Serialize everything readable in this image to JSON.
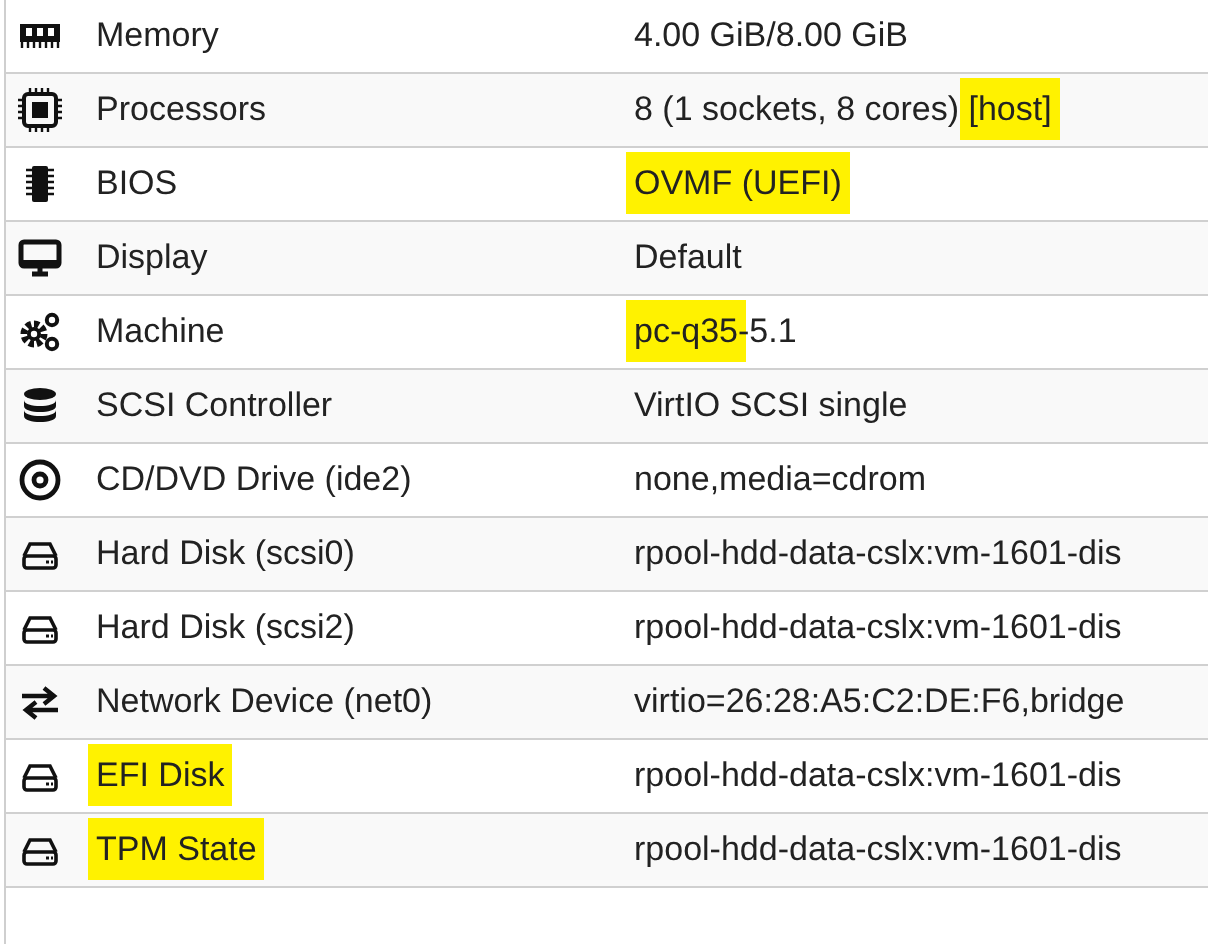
{
  "rows": [
    {
      "kind": "memory",
      "key": [
        {
          "text": "Memory",
          "highlighted": false
        }
      ],
      "value": [
        {
          "text": "4.00 GiB/8.00 GiB",
          "highlighted": false
        }
      ]
    },
    {
      "kind": "cpu",
      "key": [
        {
          "text": "Processors",
          "highlighted": false
        }
      ],
      "value": [
        {
          "text": "8 (1 sockets, 8 cores) ",
          "highlighted": false
        },
        {
          "text": "[host]",
          "highlighted": true
        }
      ]
    },
    {
      "kind": "bios",
      "key": [
        {
          "text": "BIOS",
          "highlighted": false
        }
      ],
      "value": [
        {
          "text": "OVMF (UEFI)",
          "highlighted": true
        }
      ]
    },
    {
      "kind": "display",
      "key": [
        {
          "text": "Display",
          "highlighted": false
        }
      ],
      "value": [
        {
          "text": "Default",
          "highlighted": false
        }
      ]
    },
    {
      "kind": "machine",
      "key": [
        {
          "text": "Machine",
          "highlighted": false
        }
      ],
      "value": [
        {
          "text": "pc-q35",
          "highlighted": true
        },
        {
          "text": "-5.1",
          "highlighted": false
        }
      ]
    },
    {
      "kind": "scsi",
      "key": [
        {
          "text": "SCSI Controller",
          "highlighted": false
        }
      ],
      "value": [
        {
          "text": "VirtIO SCSI single",
          "highlighted": false
        }
      ]
    },
    {
      "kind": "cdrom",
      "key": [
        {
          "text": "CD/DVD Drive (ide2)",
          "highlighted": false
        }
      ],
      "value": [
        {
          "text": "none,media=cdrom",
          "highlighted": false
        }
      ]
    },
    {
      "kind": "disk",
      "key": [
        {
          "text": "Hard Disk (scsi0)",
          "highlighted": false
        }
      ],
      "value": [
        {
          "text": "rpool-hdd-data-cslx:vm-1601-dis",
          "highlighted": false
        }
      ]
    },
    {
      "kind": "disk",
      "key": [
        {
          "text": "Hard Disk (scsi2)",
          "highlighted": false
        }
      ],
      "value": [
        {
          "text": "rpool-hdd-data-cslx:vm-1601-dis",
          "highlighted": false
        }
      ]
    },
    {
      "kind": "network",
      "key": [
        {
          "text": "Network Device (net0)",
          "highlighted": false
        }
      ],
      "value": [
        {
          "text": "virtio=26:28:A5:C2:DE:F6,bridge",
          "highlighted": false
        }
      ]
    },
    {
      "kind": "disk",
      "key": [
        {
          "text": "EFI Disk",
          "highlighted": true
        }
      ],
      "value": [
        {
          "text": "rpool-hdd-data-cslx:vm-1601-dis",
          "highlighted": false
        }
      ]
    },
    {
      "kind": "disk",
      "key": [
        {
          "text": "TPM State",
          "highlighted": true
        }
      ],
      "value": [
        {
          "text": "rpool-hdd-data-cslx:vm-1601-dis",
          "highlighted": false
        }
      ]
    }
  ]
}
